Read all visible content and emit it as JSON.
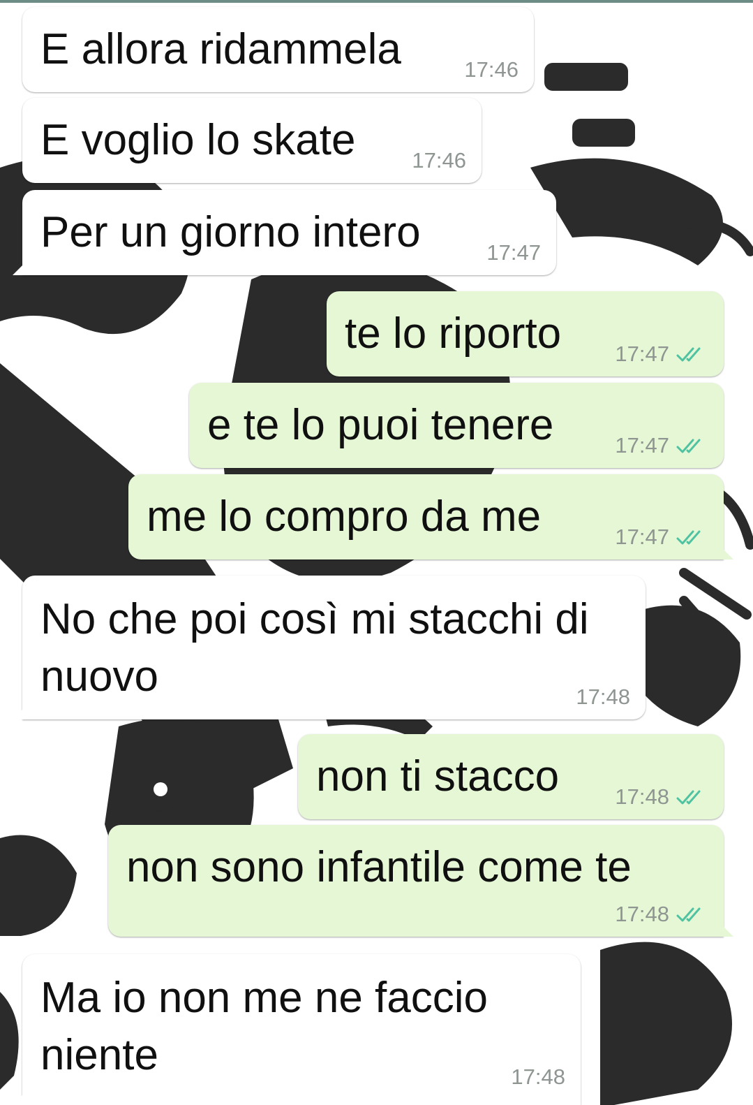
{
  "chat": {
    "messages": [
      {
        "direction": "in",
        "text": "E allora ridammela",
        "time": "17:46"
      },
      {
        "direction": "in",
        "text": "E voglio lo skate",
        "time": "17:46"
      },
      {
        "direction": "in",
        "text": "Per un giorno intero",
        "time": "17:47"
      },
      {
        "direction": "out",
        "text": "te lo riporto",
        "time": "17:47",
        "status": "read"
      },
      {
        "direction": "out",
        "text": "e te lo puoi tenere",
        "time": "17:47",
        "status": "read"
      },
      {
        "direction": "out",
        "text": "me lo compro da me",
        "time": "17:47",
        "status": "read"
      },
      {
        "direction": "in",
        "text": "No che poi così mi stacchi di nuovo",
        "time": "17:48"
      },
      {
        "direction": "out",
        "text": "non ti stacco",
        "time": "17:48",
        "status": "read"
      },
      {
        "direction": "out",
        "text": "non sono infantile come te",
        "time": "17:48",
        "status": "read"
      },
      {
        "direction": "in",
        "text": "Ma io non me ne faccio niente",
        "time": "17:48"
      }
    ]
  },
  "colors": {
    "incoming_bubble": "#ffffff",
    "outgoing_bubble": "#e6f7d6",
    "timestamp": "#8f9692",
    "read_ticks": "#4fc3a1",
    "wallpaper_ink": "#2b2b2b"
  },
  "icons": {
    "read_status": "double-check-icon"
  }
}
